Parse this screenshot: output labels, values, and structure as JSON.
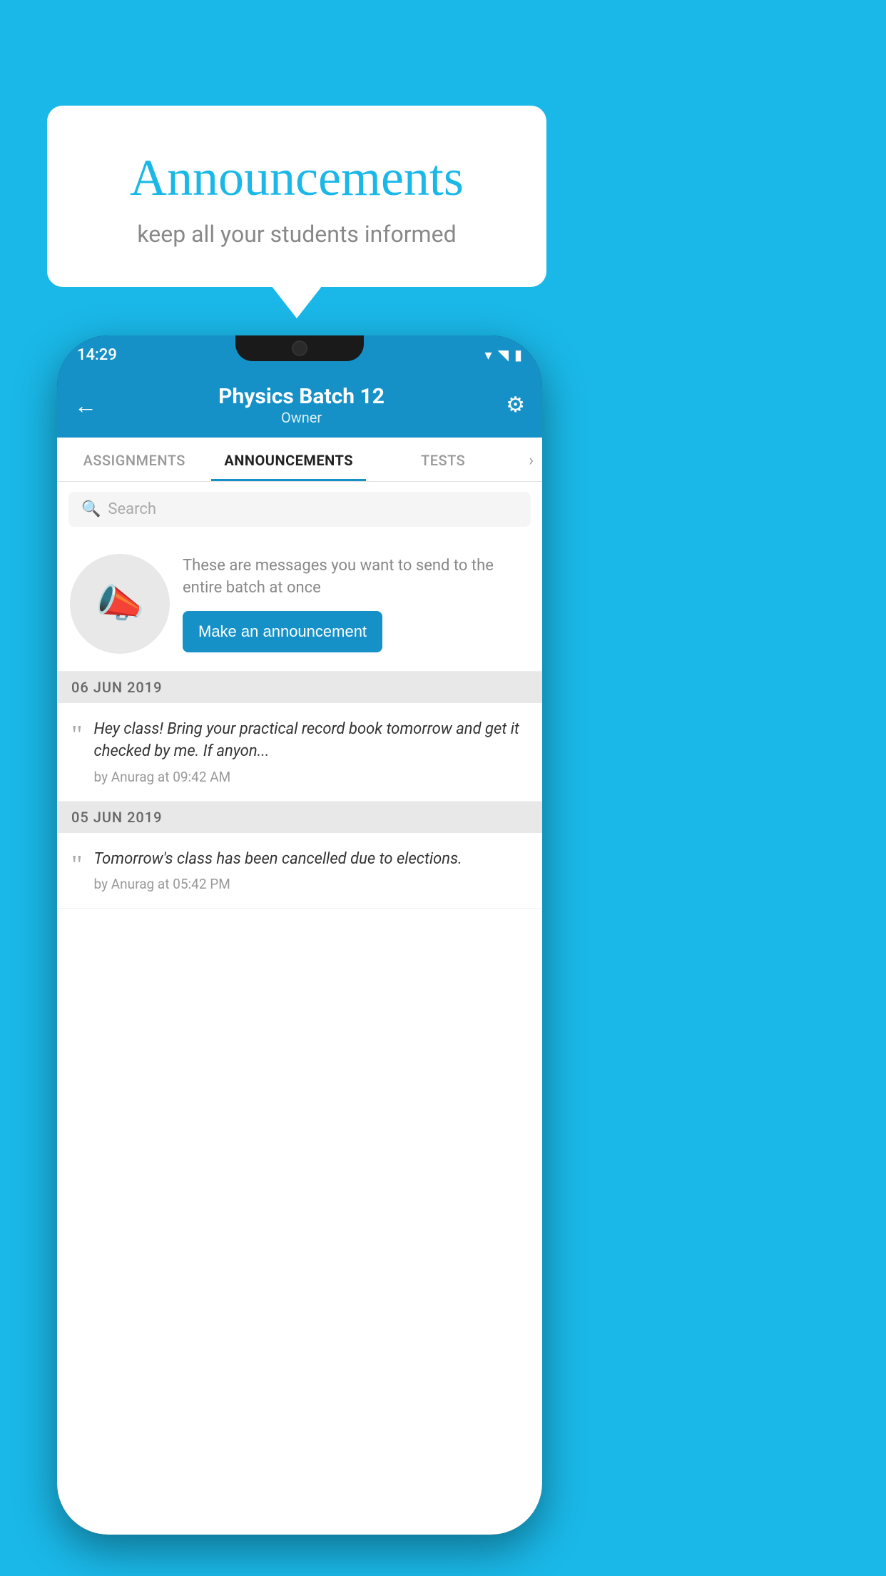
{
  "background_color": "#1ab8e8",
  "speech_bubble": {
    "title": "Announcements",
    "subtitle": "keep all your students informed"
  },
  "phone": {
    "status_bar": {
      "time": "14:29",
      "icons": [
        "wifi",
        "signal",
        "battery"
      ]
    },
    "header": {
      "title": "Physics Batch 12",
      "subtitle": "Owner",
      "back_label": "←",
      "gear_label": "⚙"
    },
    "tabs": [
      {
        "label": "ASSIGNMENTS",
        "active": false
      },
      {
        "label": "ANNOUNCEMENTS",
        "active": true
      },
      {
        "label": "TESTS",
        "active": false
      }
    ],
    "tabs_more": "›",
    "search": {
      "placeholder": "Search",
      "icon": "🔍"
    },
    "promo": {
      "description": "These are messages you want to send to the entire batch at once",
      "button_label": "Make an announcement"
    },
    "announcements": [
      {
        "date": "06  JUN  2019",
        "message": "Hey class! Bring your practical record book tomorrow and get it checked by me. If anyon...",
        "meta": "by Anurag at 09:42 AM"
      },
      {
        "date": "05  JUN  2019",
        "message": "Tomorrow's class has been cancelled due to elections.",
        "meta": "by Anurag at 05:42 PM"
      }
    ]
  }
}
